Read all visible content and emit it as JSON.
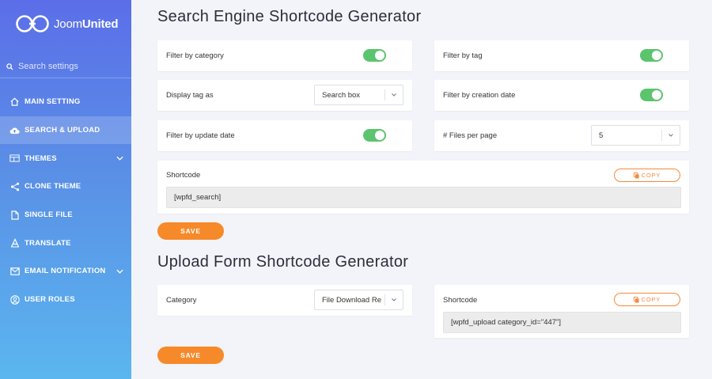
{
  "sidebar": {
    "brand_light": "Joom",
    "brand_bold": "United",
    "search_placeholder": "Search settings",
    "items": [
      {
        "label": "MAIN SETTING"
      },
      {
        "label": "SEARCH & UPLOAD"
      },
      {
        "label": "THEMES"
      },
      {
        "label": "CLONE THEME"
      },
      {
        "label": "SINGLE FILE"
      },
      {
        "label": "TRANSLATE"
      },
      {
        "label": "EMAIL NOTIFICATION"
      },
      {
        "label": "USER ROLES"
      }
    ]
  },
  "search_section": {
    "title": "Search Engine Shortcode Generator",
    "filter_category": {
      "label": "Filter by category",
      "enabled": true
    },
    "filter_tag": {
      "label": "Filter by tag",
      "enabled": true
    },
    "display_tag": {
      "label": "Display tag as",
      "value": "Search box"
    },
    "filter_creation": {
      "label": "Filter by creation date",
      "enabled": true
    },
    "filter_update": {
      "label": "Filter by update date",
      "enabled": true
    },
    "files_per_page": {
      "label": "# Files per page",
      "value": "5"
    },
    "shortcode": {
      "label": "Shortcode",
      "value": "[wpfd_search]",
      "copy_label": "COPY"
    },
    "save_label": "SAVE"
  },
  "upload_section": {
    "title": "Upload Form Shortcode Generator",
    "category": {
      "label": "Category",
      "value": "File Download Re"
    },
    "shortcode": {
      "label": "Shortcode",
      "value": "[wpfd_upload category_id=\"447\"]",
      "copy_label": "COPY"
    },
    "save_label": "SAVE"
  },
  "colors": {
    "accent": "#f68a2a",
    "toggle_on": "#5cc46d"
  }
}
